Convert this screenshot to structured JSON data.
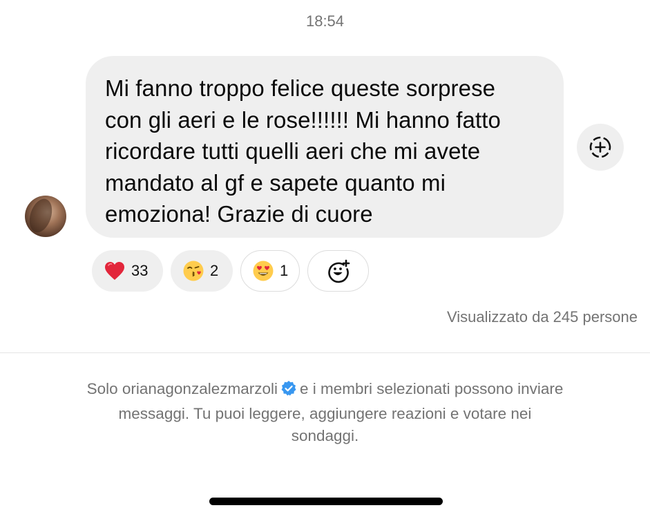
{
  "chat": {
    "timestamp": "18:54",
    "message": {
      "lines": [
        "Mi fanno troppo felice queste sorprese",
        "con gli aeri e le rose!!!!!! Mi hanno fatto",
        "ricordare tutti quelli aeri che mi avete",
        "mandato al gf e sapete quanto mi",
        "emoziona! Grazie di cuore"
      ]
    },
    "reactions": [
      {
        "emoji": "red-heart",
        "count": "33"
      },
      {
        "emoji": "face-blowing-kiss",
        "count": "2"
      },
      {
        "emoji": "heart-eyes",
        "count": "1"
      }
    ],
    "seen_by": "Visualizzato da 245 persone"
  },
  "footer": {
    "notice_before": "Solo orianagonzalezmarzoli",
    "notice_after": "e i membri selezionati possono inviare",
    "notice_line2": "messaggi. Tu puoi leggere, aggiungere reazioni e votare nei",
    "notice_line3": "sondaggi."
  },
  "colors": {
    "bubble": "#efefef",
    "muted_text": "#737373",
    "verified": "#3897f0",
    "heart": "#e2263b"
  },
  "icons": {
    "save": "add-circle-dashed-icon",
    "add_reaction": "add-reaction-icon",
    "verified": "verified-badge-icon"
  }
}
